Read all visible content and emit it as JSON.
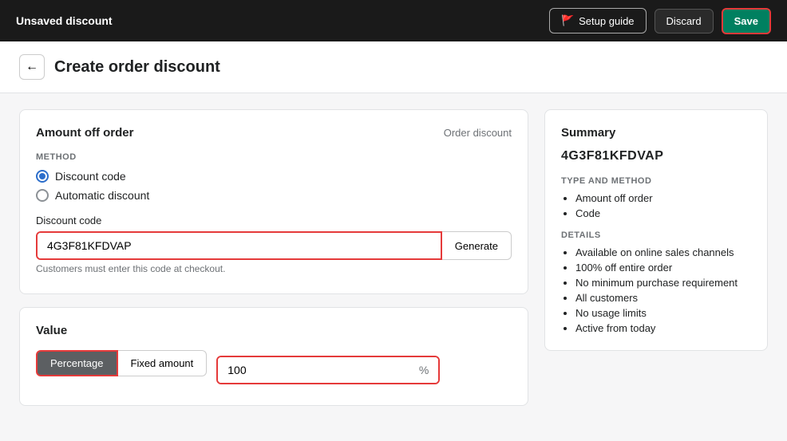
{
  "topbar": {
    "title": "Unsaved discount",
    "setup_guide_label": "Setup guide",
    "discard_label": "Discard",
    "save_label": "Save"
  },
  "page": {
    "back_label": "←",
    "title": "Create order discount"
  },
  "amount_off_order": {
    "card_title": "Amount off order",
    "card_badge": "Order discount",
    "method_label": "METHOD",
    "option_discount_code": "Discount code",
    "option_automatic": "Automatic discount",
    "discount_code_label": "Discount code",
    "discount_code_value": "4G3F81KFDVAP",
    "generate_label": "Generate",
    "field_hint": "Customers must enter this code at checkout."
  },
  "value": {
    "card_title": "Value",
    "toggle_percentage": "Percentage",
    "toggle_fixed": "Fixed amount",
    "percent_value": "100",
    "percent_symbol": "%"
  },
  "summary": {
    "title": "Summary",
    "code": "4G3F81KFDVAP",
    "type_and_method_label": "TYPE AND METHOD",
    "type_items": [
      "Amount off order",
      "Code"
    ],
    "details_label": "DETAILS",
    "detail_items": [
      "Available on online sales channels",
      "100% off entire order",
      "No minimum purchase requirement",
      "All customers",
      "No usage limits",
      "Active from today"
    ]
  }
}
